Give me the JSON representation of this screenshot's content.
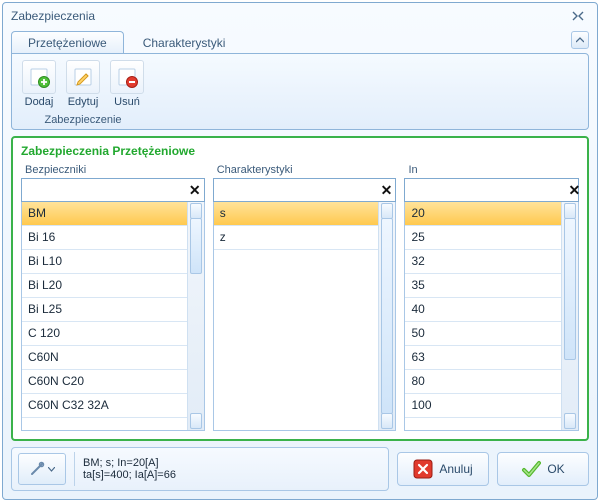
{
  "window": {
    "title": "Zabezpieczenia"
  },
  "tabs": {
    "active": "Przetężeniowe",
    "inactive": "Charakterystyki"
  },
  "ribbon": {
    "group_title": "Zabezpieczenie",
    "add": "Dodaj",
    "edit": "Edytuj",
    "delete": "Usuń"
  },
  "panel": {
    "title": "Zabezpieczenia Przetężeniowe"
  },
  "columns": {
    "fuses": {
      "label": "Bezpieczniki",
      "search": "",
      "selected_index": 0,
      "items": [
        "BM",
        "Bi 16",
        "Bi L10",
        "Bi L20",
        "Bi L25",
        "C 120",
        "C60N",
        "C60N C20",
        "C60N C32 32A"
      ]
    },
    "chars": {
      "label": "Charakterystyki",
      "search": "",
      "selected_index": 0,
      "items": [
        "s",
        "z"
      ]
    },
    "in": {
      "label": "In",
      "search": "",
      "selected_index": 0,
      "items": [
        "20",
        "25",
        "32",
        "35",
        "40",
        "50",
        "63",
        "80",
        "100"
      ]
    }
  },
  "status": {
    "line1": "BM; s; In=20[A]",
    "line2": "ta[s]=400; Ia[A]=66"
  },
  "buttons": {
    "cancel": "Anuluj",
    "ok": "OK"
  },
  "icons": {
    "tools": "tools-icon",
    "chevron_down": "chevron-down-icon",
    "chevron_up": "chevron-up-icon",
    "close": "close-icon"
  }
}
